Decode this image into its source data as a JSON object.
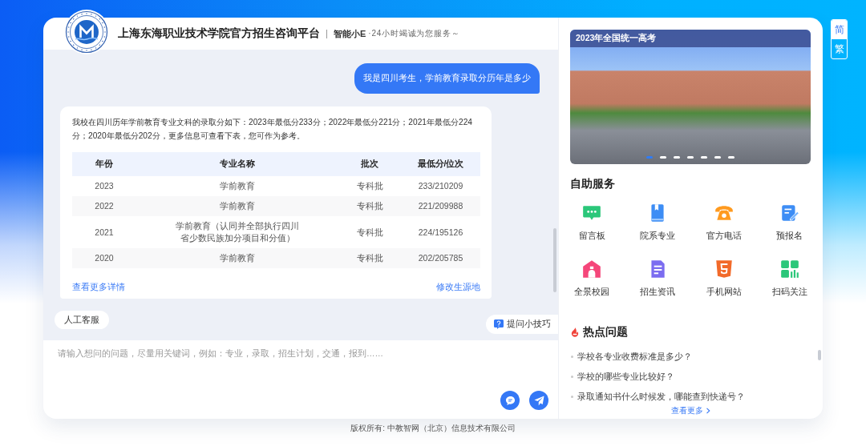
{
  "header": {
    "title": "上海东海职业技术学院官方招生咨询平台",
    "assistant_name": "智能小E",
    "tagline": "·24小时竭诚为您服务～"
  },
  "messages": [
    {
      "kind": "user",
      "text": "我是四川考生，学前教育录取分历年是多少"
    },
    {
      "kind": "bot",
      "text": "我校在四川历年学前教育专业文科的录取分如下：2023年最低分233分；2022年最低分221分；2021年最低分224分；2020年最低分202分，更多信息可查看下表，您可作为参考。",
      "table": {
        "columns": [
          "年份",
          "专业名称",
          "批次",
          "最低分/位次"
        ],
        "rows": [
          [
            "2023",
            "学前教育",
            "专科批",
            "233/210209"
          ],
          [
            "2022",
            "学前教育",
            "专科批",
            "221/209988"
          ],
          [
            "2021",
            "学前教育（认同并全部执行四川省少数民族加分项目和分值）",
            "专科批",
            "224/195126"
          ],
          [
            "2020",
            "学前教育",
            "专科批",
            "202/205785"
          ]
        ]
      },
      "links": [
        "查看更多详情",
        "修改生源地"
      ]
    }
  ],
  "quick_actions": {
    "human_service": "人工客服",
    "tips": "提问小技巧"
  },
  "input": {
    "placeholder": "请输入想问的问题，尽量用关键词，例如：专业，录取，招生计划，交通，报到……"
  },
  "language_toggle": [
    {
      "label": "简",
      "selected": true
    },
    {
      "label": "繁",
      "selected": false
    }
  ],
  "banner": {
    "title": "2023年全国统一高考",
    "slides": [
      {
        "selected": true
      },
      {
        "selected": false
      },
      {
        "selected": false
      },
      {
        "selected": false
      },
      {
        "selected": false
      },
      {
        "selected": false
      },
      {
        "selected": false
      }
    ]
  },
  "self_service": {
    "title": "自助服务",
    "items": [
      {
        "kind": "message_board",
        "label": "留言板"
      },
      {
        "kind": "department",
        "label": "院系专业"
      },
      {
        "kind": "phone",
        "label": "官方电话"
      },
      {
        "kind": "signup",
        "label": "预报名"
      },
      {
        "kind": "campus",
        "label": "全景校园"
      },
      {
        "kind": "news",
        "label": "招生资讯"
      },
      {
        "kind": "mobile_site",
        "label": "手机网站"
      },
      {
        "kind": "qrcode",
        "label": "扫码关注"
      }
    ]
  },
  "hot_questions": {
    "title": "热点问题",
    "items": [
      "学校各专业收费标准是多少？",
      "学校的哪些专业比较好？",
      "录取通知书什么时候发，哪能查到快递号？"
    ],
    "more": "查看更多"
  },
  "footer": "版权所有: 中教智网（北京）信息技术有限公司"
}
